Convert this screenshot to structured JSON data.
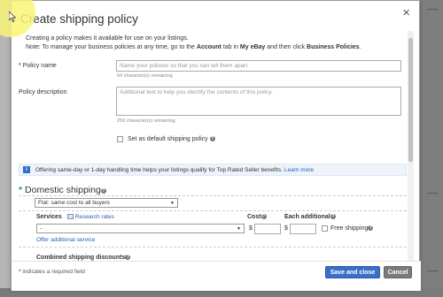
{
  "modal": {
    "title": "Create shipping policy",
    "close_label": "×"
  },
  "intro": {
    "line1": "Creating a policy makes it available for use on your listings.",
    "line2_prefix": "Note: To manage your business policies at any time, go to the",
    "line2_account": "Account",
    "line2_middle": "tab in",
    "line2_myebay": "My eBay",
    "line2_then": "and then click",
    "line2_bp": "Business Policies",
    "line2_end": "."
  },
  "policy_name": {
    "star": "*",
    "label": "Policy name",
    "placeholder": "Name your policies so that you can tell them apart",
    "remaining": "64 character(s) remaining"
  },
  "policy_description": {
    "label": "Policy description",
    "placeholder": "Additional text to help you identify the contents of this policy.",
    "remaining": "250 character(s) remaining"
  },
  "default_policy": {
    "label": "Set as default shipping policy",
    "help": "?"
  },
  "info": {
    "icon": "i",
    "text": "Offering same-day or 1-day handling time helps your listings qualify for Top Rated Seller benefits.",
    "link": "Learn more"
  },
  "domestic": {
    "star": "*",
    "title": "Domestic shipping",
    "help": "?",
    "method_selected": "Flat: same cost to all buyers",
    "services_label": "Services",
    "research_rates": "Research rates",
    "cost_label": "Cost",
    "each_additional_label": "Each additional",
    "service_selected": "-",
    "dollar": "$",
    "free_shipping": "Free shipping",
    "offer_additional": "Offer additional service",
    "combined_discounts": "Combined shipping discounts"
  },
  "footer": {
    "required_note": "indicates a required field",
    "star": "*",
    "save_close": "Save and close",
    "cancel": "Cancel"
  },
  "colors": {
    "primary_button": "#3a6fc8",
    "link": "#1f5fbf",
    "required_star": "#2e9b3b",
    "cursor_highlight": "#faf578"
  }
}
